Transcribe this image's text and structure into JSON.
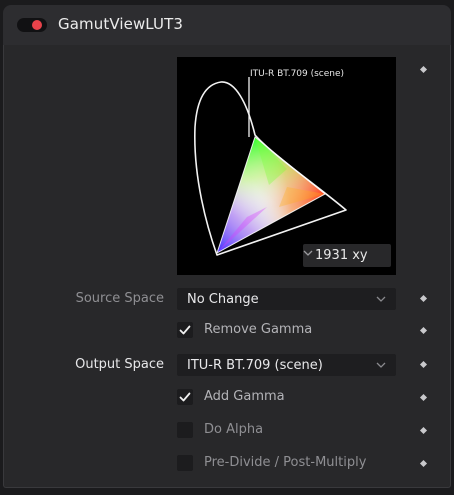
{
  "tool": {
    "title": "GamutViewLUT3",
    "enabled": true,
    "toggle_color": "#e8434b"
  },
  "gamut_view": {
    "gamut_label": "ITU-R BT.709 (scene)",
    "view_mode": "1931 xy"
  },
  "source_space": {
    "label": "Source Space",
    "value": "No Change"
  },
  "remove_gamma": {
    "label": "Remove Gamma",
    "checked": true
  },
  "output_space": {
    "label": "Output Space",
    "value": "ITU-R BT.709 (scene)"
  },
  "add_gamma": {
    "label": "Add Gamma",
    "checked": true
  },
  "do_alpha": {
    "label": "Do Alpha",
    "checked": false
  },
  "pre_divide": {
    "label": "Pre-Divide / Post-Multiply",
    "checked": false
  },
  "icons": [
    "power-toggle-icon",
    "chevron-down-icon",
    "checkmark-icon",
    "keyframe-diamond-icon"
  ]
}
